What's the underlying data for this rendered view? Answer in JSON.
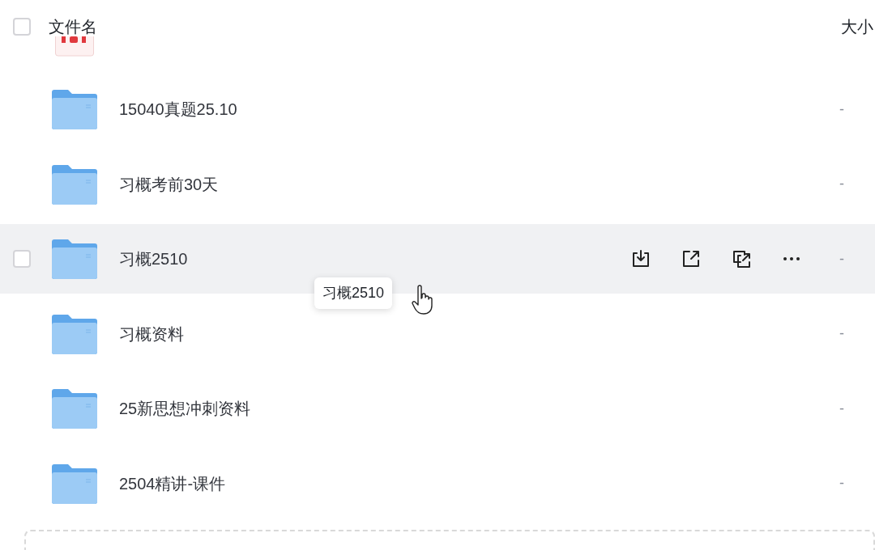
{
  "header": {
    "checked": false,
    "name_label": "文件名",
    "size_label": "大小"
  },
  "clipped_file": {
    "kind": "pdf"
  },
  "files": [
    {
      "kind": "folder",
      "name": "15040真题25.10",
      "size": "-",
      "hovered": false,
      "checked": false
    },
    {
      "kind": "folder",
      "name": "习概考前30天",
      "size": "-",
      "hovered": false,
      "checked": false
    },
    {
      "kind": "folder",
      "name": "习概2510",
      "size": "-",
      "hovered": true,
      "checked": false
    },
    {
      "kind": "folder",
      "name": "习概资料",
      "size": "-",
      "hovered": false,
      "checked": false
    },
    {
      "kind": "folder",
      "name": "25新思想冲刺资料",
      "size": "-",
      "hovered": false,
      "checked": false
    },
    {
      "kind": "folder",
      "name": "2504精讲-课件",
      "size": "-",
      "hovered": false,
      "checked": false
    }
  ],
  "tooltip": {
    "text": "习概2510"
  }
}
